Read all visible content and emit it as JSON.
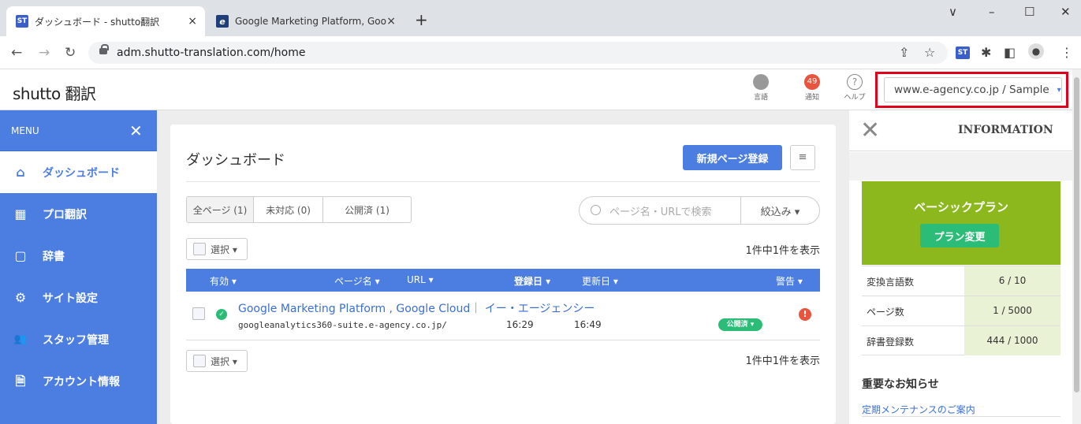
{
  "browser": {
    "tabs": [
      {
        "favicon": "ST",
        "title": "ダッシュボード - shutto翻訳",
        "close": "×"
      },
      {
        "favicon": "e",
        "title": "Google Marketing Platform, Goo",
        "close": "×"
      }
    ],
    "new_tab": "+",
    "window_controls": {
      "dropdown": "∨",
      "minimize": "–",
      "maximize": "☐",
      "close": "✕"
    },
    "nav": {
      "back": "←",
      "forward": "→",
      "reload": "↻"
    },
    "url": "adm.shutto-translation.com/home"
  },
  "header": {
    "logo": "shutto 翻訳",
    "language_label": "言語",
    "notification_label": "通知",
    "notification_count": "49",
    "help_label": "ヘルプ",
    "help_glyph": "?",
    "site_selector": "www.e-agency.co.jp / Sample",
    "site_selector_caret": "▾"
  },
  "sidebar": {
    "title": "MENU",
    "close": "✕",
    "items": [
      {
        "label": "ダッシュボード",
        "icon": "home-icon",
        "glyph": "⌂"
      },
      {
        "label": "プロ翻訳",
        "icon": "grid-icon",
        "glyph": "▦"
      },
      {
        "label": "辞書",
        "icon": "book-icon",
        "glyph": "▢"
      },
      {
        "label": "サイト設定",
        "icon": "gear-icon",
        "glyph": "⚙"
      },
      {
        "label": "スタッフ管理",
        "icon": "users-icon",
        "glyph": "👥"
      },
      {
        "label": "アカウント情報",
        "icon": "document-icon",
        "glyph": "🗎"
      }
    ]
  },
  "main": {
    "title": "ダッシュボード",
    "new_page_button": "新規ページ登録",
    "menu_glyph": "≡",
    "filter_tabs": [
      "全ページ (1)",
      "未対応 (0)",
      "公開済 (1)"
    ],
    "search_placeholder": "ページ名・URLで検索",
    "narrow_label": "絞込み ▾",
    "select_label": "選択 ▾",
    "count_text": "1件中1件を表示",
    "table_headers": {
      "enabled": "有効 ▾",
      "page_name": "ページ名 ▾",
      "url": "URL ▾",
      "registered": "登録日 ▾",
      "updated": "更新日 ▾",
      "warning": "警告 ▾"
    },
    "rows": [
      {
        "title": "Google Marketing Platform , Google Cloud｜ イー・エージェンシー",
        "url": "googleanalytics360-suite.e-agency.co.jp/",
        "registered": "16:29",
        "updated": "16:49",
        "status": "公開済 ▾",
        "warning": "!"
      }
    ]
  },
  "info": {
    "close": "✕",
    "title": "INFORMATION",
    "plan_name": "ベーシックプラン",
    "plan_change": "プラン変更",
    "stats": [
      {
        "label": "変換言語数",
        "value": "6 / 10"
      },
      {
        "label": "ページ数",
        "value": "1 / 5000"
      },
      {
        "label": "辞書登録数",
        "value": "444 / 1000"
      }
    ],
    "notice_title": "重要なお知らせ",
    "notice_link": "定期メンテナンスのご案内"
  }
}
